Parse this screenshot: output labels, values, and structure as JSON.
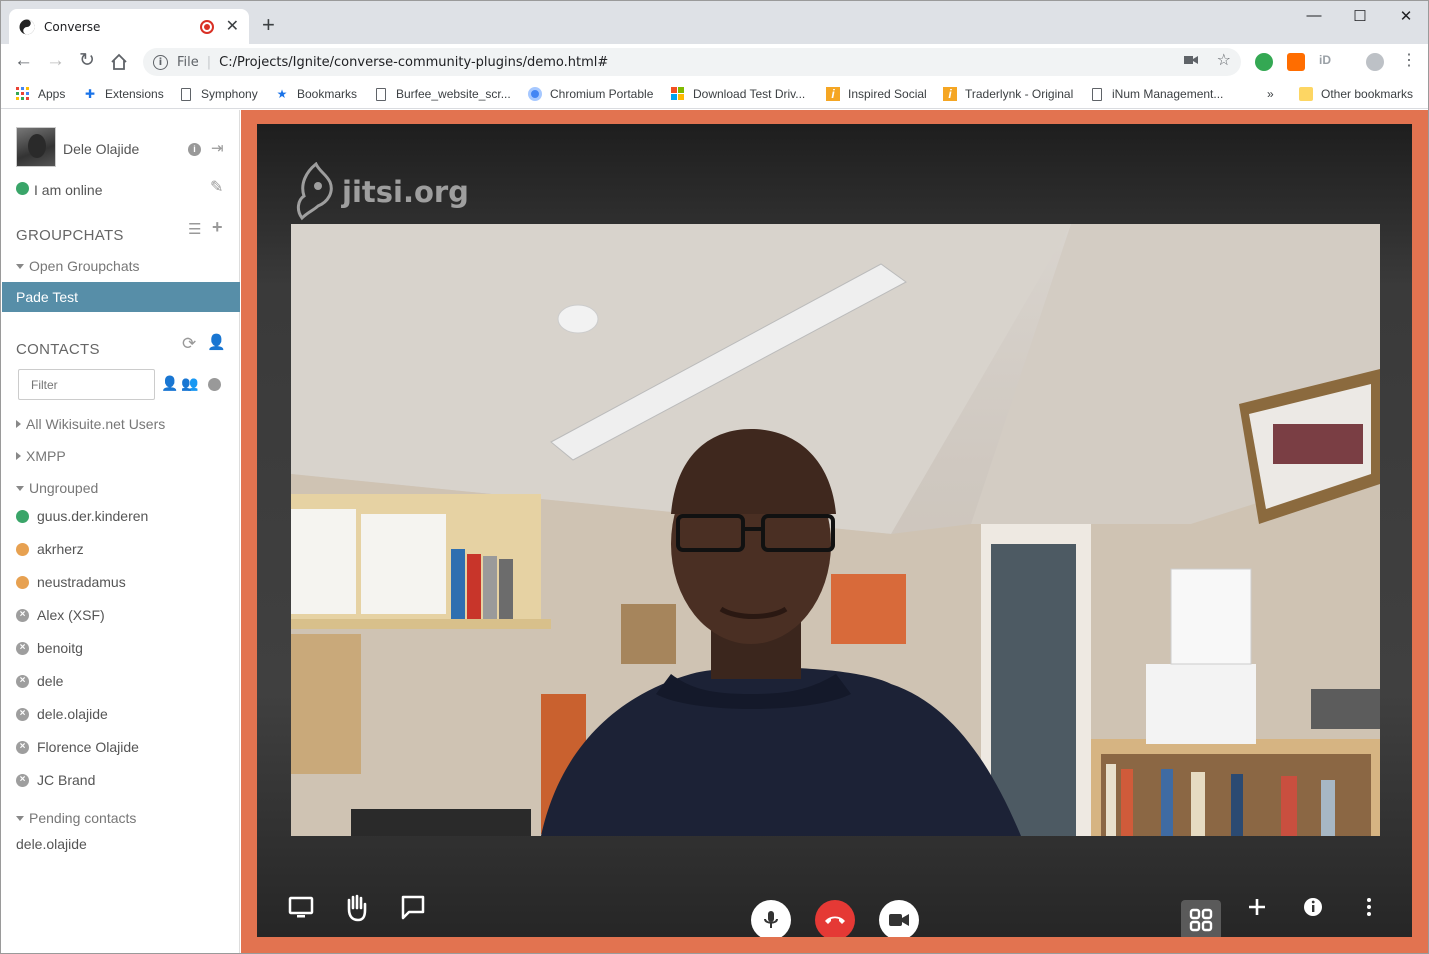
{
  "browser": {
    "tab_title": "Converse",
    "new_tab": "+",
    "scheme": "File",
    "url": "C:/Projects/Ignite/converse-community-plugins/demo.html#",
    "window_controls": {
      "minimize": "—",
      "maximize": "☐",
      "close": "✕"
    }
  },
  "bookmarks": {
    "items": [
      {
        "label": "Apps",
        "icon": "apps-grid-icon"
      },
      {
        "label": "Extensions",
        "icon": "puzzle-icon"
      },
      {
        "label": "Symphony",
        "icon": "page-icon"
      },
      {
        "label": "Bookmarks",
        "icon": "star-icon"
      },
      {
        "label": "Burfee_website_scr...",
        "icon": "page-icon"
      },
      {
        "label": "Chromium Portable",
        "icon": "chromium-icon"
      },
      {
        "label": "Download Test Driv...",
        "icon": "windows-icon"
      },
      {
        "label": "Inspired Social",
        "icon": "brand-icon"
      },
      {
        "label": "Traderlynk - Original",
        "icon": "brand-icon"
      },
      {
        "label": "iNum Management...",
        "icon": "page-icon"
      }
    ],
    "overflow": "»",
    "other": "Other bookmarks"
  },
  "sidebar": {
    "user": {
      "name": "Dele Olajide",
      "status": "I am online"
    },
    "groupchats": {
      "title": "GROUPCHATS",
      "open_label": "Open Groupchats",
      "rooms": [
        {
          "name": "Pade Test"
        }
      ]
    },
    "contacts": {
      "title": "CONTACTS",
      "filter_placeholder": "Filter",
      "groups": [
        {
          "label": "All Wikisuite.net Users"
        },
        {
          "label": "XMPP"
        }
      ],
      "ungrouped_label": "Ungrouped",
      "list": [
        {
          "name": "guus.der.kinderen",
          "status": "online"
        },
        {
          "name": "akrherz",
          "status": "away"
        },
        {
          "name": "neustradamus",
          "status": "away"
        },
        {
          "name": "Alex (XSF)",
          "status": "offline"
        },
        {
          "name": "benoitg",
          "status": "offline"
        },
        {
          "name": "dele",
          "status": "offline"
        },
        {
          "name": "dele.olajide",
          "status": "offline"
        },
        {
          "name": "Florence Olajide",
          "status": "offline"
        },
        {
          "name": "JC Brand",
          "status": "offline"
        }
      ],
      "pending_label": "Pending contacts",
      "pending": [
        {
          "name": "dele.olajide"
        }
      ]
    }
  },
  "jitsi": {
    "watermark": "jitsi.org",
    "colors": {
      "frame": "#e27350",
      "hangup": "#e53935",
      "active_room": "#578ea8"
    }
  }
}
